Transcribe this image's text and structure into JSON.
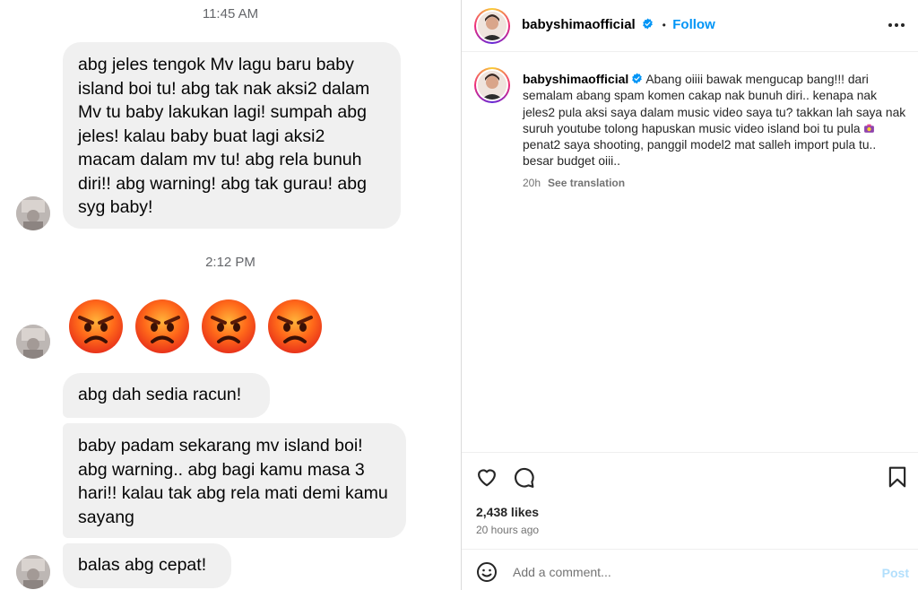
{
  "chat": {
    "timestamps": [
      "11:45 AM",
      "2:12 PM"
    ],
    "messages": [
      "abg jeles tengok Mv lagu baru baby island boi tu! abg tak nak aksi2 dalam Mv tu baby lakukan lagi! sumpah abg jeles! kalau baby buat lagi aksi2 macam dalam mv tu! abg rela bunuh diri!! abg warning! abg tak gurau! abg syg baby!",
      "abg dah sedia racun!",
      "baby padam sekarang mv island boi! abg warning.. abg bagi kamu masa 3 hari!! kalau tak abg rela mati demi kamu sayang",
      "balas abg cepat!"
    ],
    "emoji_reaction": {
      "icon": "angry-face-emoji",
      "count": 4
    }
  },
  "post": {
    "username": "babyshimaofficial",
    "follow_label": "Follow",
    "follow_separator": "•",
    "caption": "Abang oiiii bawak mengucap bang!!! dari semalam abang spam komen cakap nak bunuh diri.. kenapa nak jeles2 pula aksi saya dalam music video saya tu? takkan lah saya nak suruh youtube tolong hapuskan music video island boi tu pula",
    "caption_after_emoji": " penat2 saya shooting, panggil model2 mat salleh import pula tu.. besar budget oiii..",
    "caption_time": "20h",
    "see_translation": "See translation",
    "likes": "2,438 likes",
    "posted_ago": "20 hours ago",
    "comment_placeholder": "Add a comment...",
    "post_label": "Post",
    "icons": [
      "verified-badge-icon",
      "more-options-icon",
      "heart-icon",
      "comment-icon",
      "bookmark-icon",
      "emoji-smile-icon"
    ],
    "colors": {
      "accent": "#0095f6",
      "post_disabled": "#b2dffc"
    }
  }
}
